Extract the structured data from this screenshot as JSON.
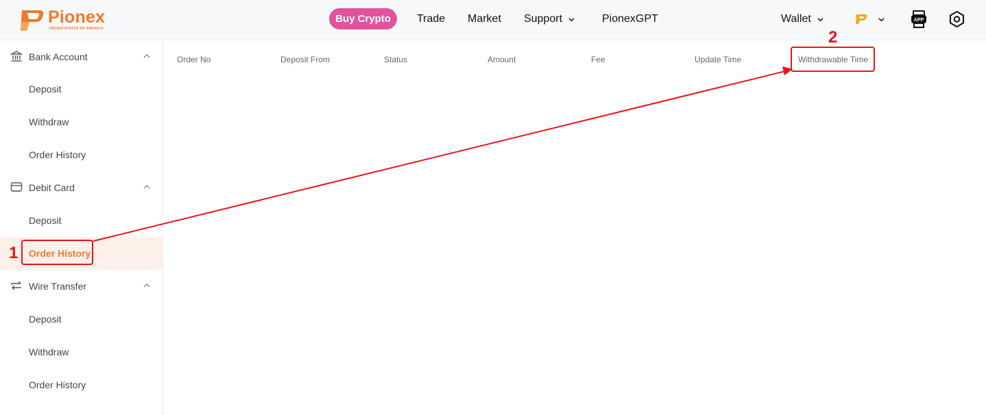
{
  "brand": {
    "name": "Pionex",
    "subtitle": "UNITED STATES OF AMERICA",
    "color": "#f07a2b"
  },
  "nav": {
    "buy_crypto": "Buy Crypto",
    "trade": "Trade",
    "market": "Market",
    "support": "Support",
    "gpt": "PionexGPT",
    "wallet": "Wallet",
    "app_icon": "app-download-icon",
    "settings_icon": "settings-hex-icon",
    "buy_color": "#e2539c"
  },
  "sidebar": {
    "groups": [
      {
        "label": "Bank Account",
        "icon": "bank-icon",
        "items": [
          "Deposit",
          "Withdraw",
          "Order History"
        ]
      },
      {
        "label": "Debit Card",
        "icon": "card-icon",
        "items": [
          "Deposit",
          "Order History"
        ]
      },
      {
        "label": "Wire Transfer",
        "icon": "transfer-icon",
        "items": [
          "Deposit",
          "Withdraw",
          "Order History"
        ]
      }
    ],
    "active_item": "Debit Card / Order History"
  },
  "table": {
    "columns": [
      "Order No",
      "Deposit From",
      "Status",
      "Amount",
      "Fee",
      "Update Time",
      "Withdrawable Time"
    ],
    "rows": []
  },
  "annotations": {
    "step1": "1",
    "step2": "2",
    "color": "#e8141a"
  }
}
